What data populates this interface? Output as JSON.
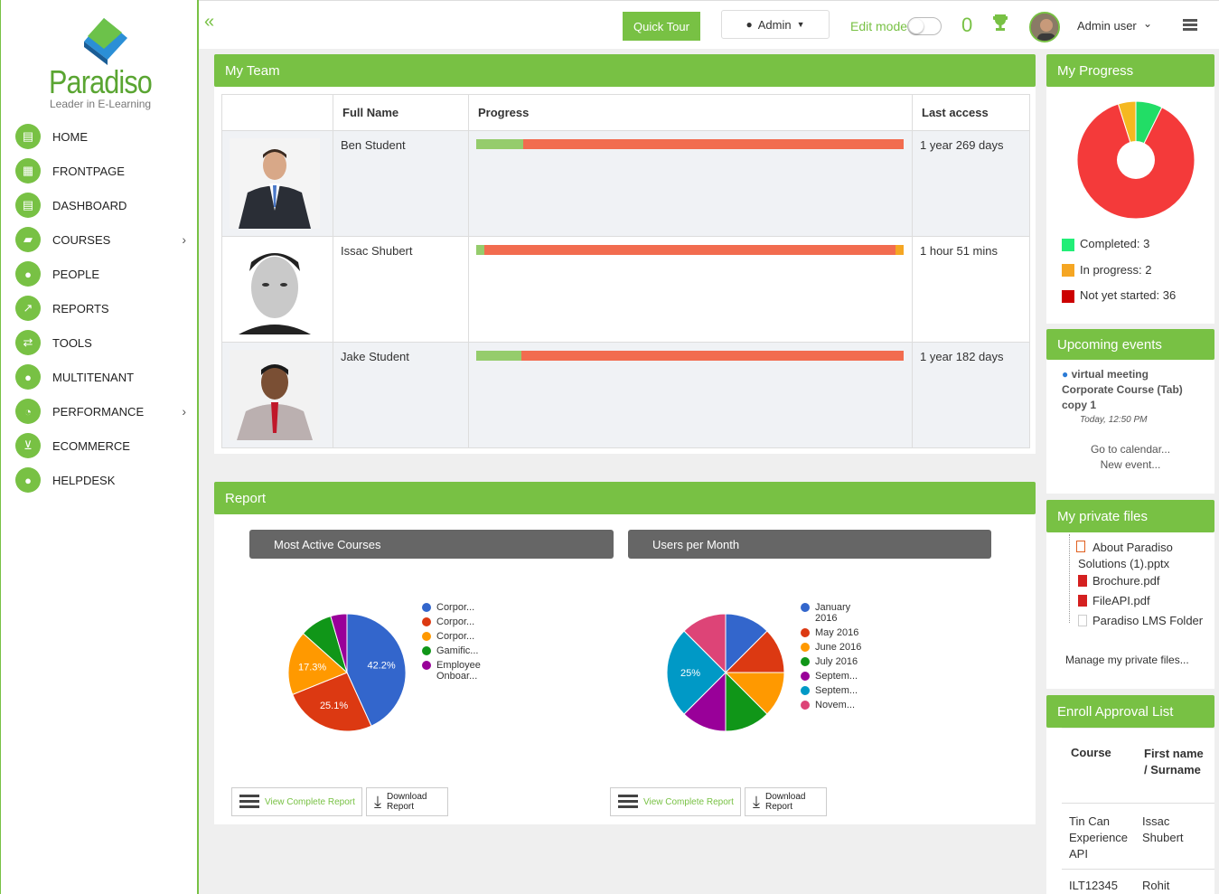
{
  "brand": {
    "name": "Paradiso",
    "tagline": "Leader in E-Learning"
  },
  "nav": [
    {
      "label": "HOME",
      "icon": "home-icon",
      "glyph": "▤"
    },
    {
      "label": "FRONTPAGE",
      "icon": "frontpage-icon",
      "glyph": "▦"
    },
    {
      "label": "DASHBOARD",
      "icon": "dashboard-icon",
      "glyph": "▤"
    },
    {
      "label": "COURSES",
      "icon": "folder-icon",
      "glyph": "▰"
    },
    {
      "label": "PEOPLE",
      "icon": "people-icon",
      "glyph": "●"
    },
    {
      "label": "REPORTS",
      "icon": "chart-icon",
      "glyph": "↗"
    },
    {
      "label": "TOOLS",
      "icon": "tools-icon",
      "glyph": "⇄"
    },
    {
      "label": "MULTITENANT",
      "icon": "multitenant-icon",
      "glyph": "●"
    },
    {
      "label": "PERFORMANCE",
      "icon": "performance-icon",
      "glyph": "◔"
    },
    {
      "label": "ECOMMERCE",
      "icon": "cart-icon",
      "glyph": "⊻"
    },
    {
      "label": "HELPDESK",
      "icon": "chat-icon",
      "glyph": "●"
    }
  ],
  "topbar": {
    "collapse": "«",
    "quick_tour": "Quick Tour",
    "admin_label": "Admin",
    "edit_mode": "Edit mode",
    "count": "0",
    "user": "Admin user"
  },
  "my_team": {
    "title": "My Team",
    "columns": [
      "",
      "Full Name",
      "Progress",
      "Last access"
    ],
    "rows": [
      {
        "name": "Ben Student",
        "progress": {
          "completed": 0.11,
          "in_progress": 0,
          "not_started": 0.89
        },
        "last_access": "1 year 269 days"
      },
      {
        "name": "Issac Shubert",
        "progress": {
          "completed": 0.02,
          "in_progress": 0.02,
          "not_started": 0.96
        },
        "last_access": "1 hour 51 mins"
      },
      {
        "name": "Jake Student",
        "progress": {
          "completed": 0.105,
          "in_progress": 0,
          "not_started": 0.895
        },
        "last_access": "1 year 182 days"
      }
    ]
  },
  "report": {
    "title": "Report",
    "tabs": [
      "Most Active Courses",
      "Users per Month"
    ],
    "view_report": "View Complete Report",
    "download_1": "Download",
    "download_2": "Report"
  },
  "chart_data": [
    {
      "type": "pie",
      "title": "Most Active Courses",
      "labels": [
        "Corpor...",
        "Corpor...",
        "Corpor...",
        "Gamific...",
        "Employee Onboar..."
      ],
      "values": [
        42.2,
        25.1,
        17.3,
        8.7,
        4.4
      ],
      "colors": [
        "#3366cc",
        "#dc3912",
        "#ff9900",
        "#109618",
        "#990099"
      ],
      "data_labels": [
        "42.2%",
        "25.1%",
        "17.3%",
        "",
        ""
      ]
    },
    {
      "type": "pie",
      "title": "Users per Month",
      "labels": [
        "January 2016",
        "May 2016",
        "June 2016",
        "July 2016",
        "Septem...",
        "Septem...",
        "Novem..."
      ],
      "values": [
        12.5,
        12.5,
        12.5,
        12.5,
        12.5,
        25,
        12.5
      ],
      "colors": [
        "#3366cc",
        "#dc3912",
        "#ff9900",
        "#109618",
        "#990099",
        "#0099c6",
        "#dd4477"
      ],
      "data_labels": [
        "",
        "",
        "",
        "",
        "",
        "25%",
        ""
      ]
    }
  ],
  "my_progress": {
    "title": "My Progress",
    "chart": {
      "type": "pie",
      "values": [
        3,
        2,
        36
      ],
      "colors": [
        "#22dd66",
        "#f5b820",
        "#f43a3a"
      ]
    },
    "legend": [
      {
        "label": "Completed: 3",
        "color": "#22ee77"
      },
      {
        "label": "In progress: 2",
        "color": "#f5a623"
      },
      {
        "label": "Not yet started: 36",
        "color": "#cc0000"
      }
    ]
  },
  "events": {
    "title": "Upcoming events",
    "event_name": "virtual meeting",
    "event_course": "Corporate Course (Tab) copy 1",
    "event_time": "Today, 12:50 PM",
    "goto": "Go to calendar...",
    "new_event": "New event..."
  },
  "files": {
    "title": "My private files",
    "items": [
      "About Paradiso Solutions (1).pptx",
      "Brochure.pdf",
      "FileAPI.pdf",
      "Paradiso LMS Folder"
    ],
    "manage": "Manage my private files..."
  },
  "enroll": {
    "title": "Enroll Approval List",
    "col_course": "Course",
    "col_name": "First name / Surname",
    "rows": [
      {
        "course": "Tin Can Experience API",
        "name": "Issac Shubert"
      },
      {
        "course": "ILT12345",
        "name": "Rohit"
      }
    ]
  }
}
